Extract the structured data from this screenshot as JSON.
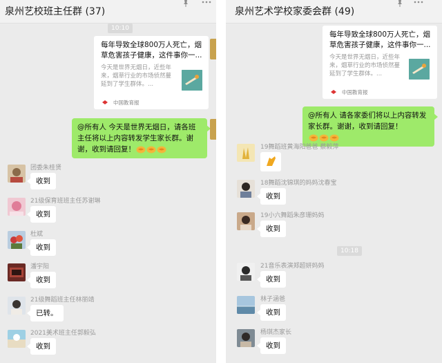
{
  "left_chat": {
    "title": "泉州艺校班主任群 (37)",
    "timestamp": "10:10",
    "shared_card": {
      "title": "每年导致全球800万人死亡，烟草危害孩子健康，这件事你一...",
      "description": "今天是世界无烟日，近些年来，烟草行业的市场侦然蔓延到了学生群体。...",
      "source": "中国教育报"
    },
    "announcement": {
      "text": "@所有人 今天是世界无烟日，请各班主任将以上内容转发学生家长群。谢谢，收到请回复！",
      "emoji": [
        "clap-emoji",
        "clap-emoji",
        "clap-emoji"
      ]
    },
    "messages": [
      {
        "sender": "团委朱桂贤",
        "text": "收到"
      },
      {
        "sender": "21级保育班班主任苏谢琳",
        "text": "收到"
      },
      {
        "sender": "杜斌",
        "text": "收到"
      },
      {
        "sender": "潘宇阳",
        "text": "收到"
      },
      {
        "sender": "21级舞蹈班主任林丽靖",
        "text": "已转。"
      },
      {
        "sender": "2021美术班主任郭毅弘",
        "text": "收到"
      }
    ]
  },
  "right_chat": {
    "title": "泉州艺术学校家委会群 (49)",
    "shared_card": {
      "title": "每年导致全球800万人死亡，烟草危害孩子健康，这件事你一...",
      "description": "今天是世界无烟日，近些年来，烟草行业的市场侦然蔓延到了学生群体。...",
      "source": "中国教育报"
    },
    "announcement": {
      "text": "@所有人 请各家委们将以上内容转发家长群。谢谢，收到请回复！",
      "emoji": [
        "clap-emoji",
        "clap-emoji",
        "clap-emoji"
      ]
    },
    "messages_before_time": [
      {
        "sender": "19舞蹈班黄海阳爸爸 蔡毅萍",
        "sticker": "clap-sticker"
      },
      {
        "sender": "18舞蹈沈锦琪的妈妈沈春宝",
        "text": "收到"
      },
      {
        "sender": "19小六舞蹈朱彦珊妈妈",
        "text": "收到"
      }
    ],
    "timestamp": "10:18",
    "messages_after_time": [
      {
        "sender": "21音乐表演郑超妍妈妈",
        "text": "收到"
      },
      {
        "sender": "林子涵爸",
        "text": "收到"
      },
      {
        "sender": "杨琪杰家长",
        "text": "收到"
      }
    ]
  },
  "colors": {
    "chat_background": "#ebebeb",
    "self_bubble": "#9eea6a",
    "other_bubble": "#ffffff",
    "name_text": "#9a9a9a"
  }
}
